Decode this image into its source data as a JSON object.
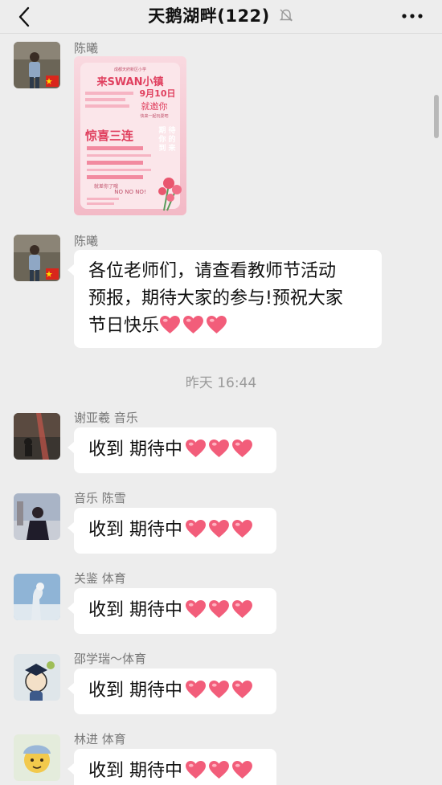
{
  "header": {
    "title": "天鹅湖畔(122)",
    "back_icon": "chevron-left-icon",
    "mute_icon": "bell-off-icon",
    "more_icon": "ellipsis-icon"
  },
  "messages": [
    {
      "sender": "陈曦",
      "type": "image",
      "poster": {
        "school": "成都天府新区小学",
        "headline_a": "来SWAN小镇",
        "date": "9月10日",
        "invite": "就邀你",
        "tagline": "快来一起玩耍吧",
        "feature": "惊喜三连",
        "side": "期待你的到来",
        "footer_a": "就差你了哦",
        "footer_b": "NO NO NO!"
      }
    },
    {
      "sender": "陈曦",
      "type": "text",
      "lines": [
        "各位老师们，请查看教师节活动",
        "预报，期待大家的参与!预祝大家",
        "节日快乐"
      ]
    }
  ],
  "timestamp": "昨天 16:44",
  "replies": [
    {
      "sender": "谢亚羲 音乐",
      "text": "收到 期待中"
    },
    {
      "sender": "音乐 陈雪",
      "text": "收到 期待中"
    },
    {
      "sender": "关鉴 体育",
      "text": "收到 期待中"
    },
    {
      "sender": "邵学瑞～体育",
      "text": "收到 期待中"
    },
    {
      "sender": "林进 体育",
      "text": "收到 期待中"
    }
  ],
  "colors": {
    "background": "#ededed",
    "bubble": "#ffffff",
    "heart": "#f25d7a",
    "poster_pink": "#f6c9d3"
  }
}
